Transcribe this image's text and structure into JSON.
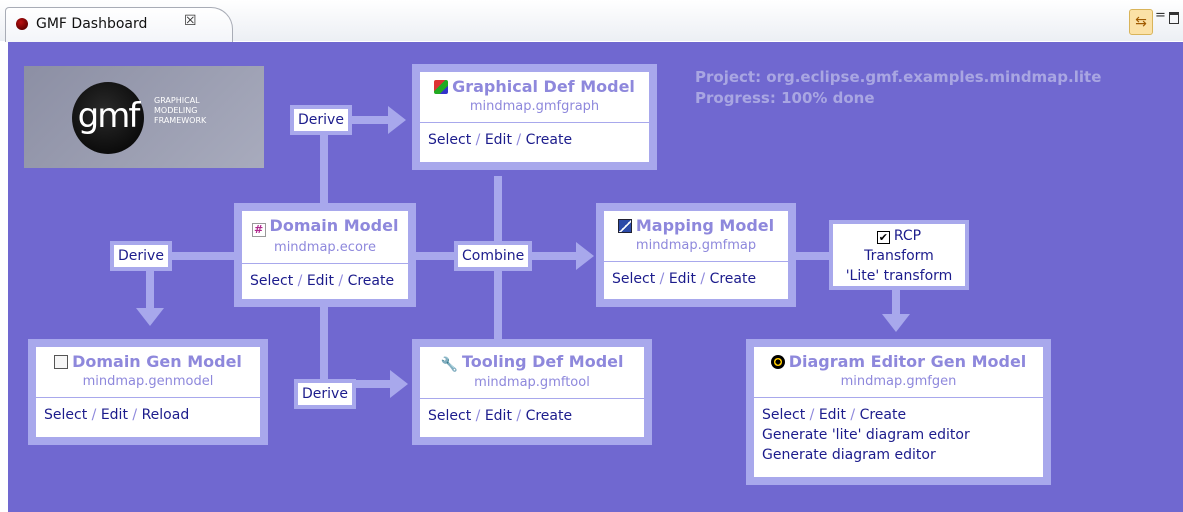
{
  "tab": {
    "title": "GMF Dashboard",
    "close": "☒"
  },
  "toolbar": {
    "sync_icon": "⇆",
    "minimize": "=",
    "maximize": ""
  },
  "logo": {
    "brand": "gmf",
    "line1": "GRAPHICAL",
    "line2": "MODELING",
    "line3": "FRAMEWORK"
  },
  "status": {
    "project": "Project: org.eclipse.gmf.examples.mindmap.lite",
    "progress": "Progress: 100% done"
  },
  "cards": {
    "graphical": {
      "title": "Graphical Def Model",
      "file": "mindmap.gmfgraph",
      "icon": "palette-icon",
      "links": [
        "Select",
        "Edit",
        "Create"
      ]
    },
    "domain": {
      "title": "Domain Model",
      "file": "mindmap.ecore",
      "icon": "ecore-icon",
      "links": [
        "Select",
        "Edit",
        "Create"
      ]
    },
    "mapping": {
      "title": "Mapping Model",
      "file": "mindmap.gmfmap",
      "icon": "map-icon",
      "links": [
        "Select",
        "Edit",
        "Create"
      ]
    },
    "domaingen": {
      "title": "Domain Gen Model",
      "file": "mindmap.genmodel",
      "icon": "genmodel-icon",
      "links": [
        "Select",
        "Edit",
        "Reload"
      ]
    },
    "tooling": {
      "title": "Tooling Def Model",
      "file": "mindmap.gmftool",
      "icon": "wrench-icon",
      "links": [
        "Select",
        "Edit",
        "Create"
      ]
    },
    "diagram": {
      "title": "Diagram Editor Gen Model",
      "file": "mindmap.gmfgen",
      "icon": "radiation-icon",
      "links": [
        "Select",
        "Edit",
        "Create"
      ],
      "extra": [
        "Generate 'lite' diagram editor",
        "Generate diagram editor"
      ]
    }
  },
  "actions": {
    "derive": "Derive",
    "combine": "Combine"
  },
  "rcp": {
    "checkbox": "RCP",
    "checked": "✔",
    "transform": "Transform",
    "lite_transform": "'Lite' transform"
  },
  "separator": "/"
}
